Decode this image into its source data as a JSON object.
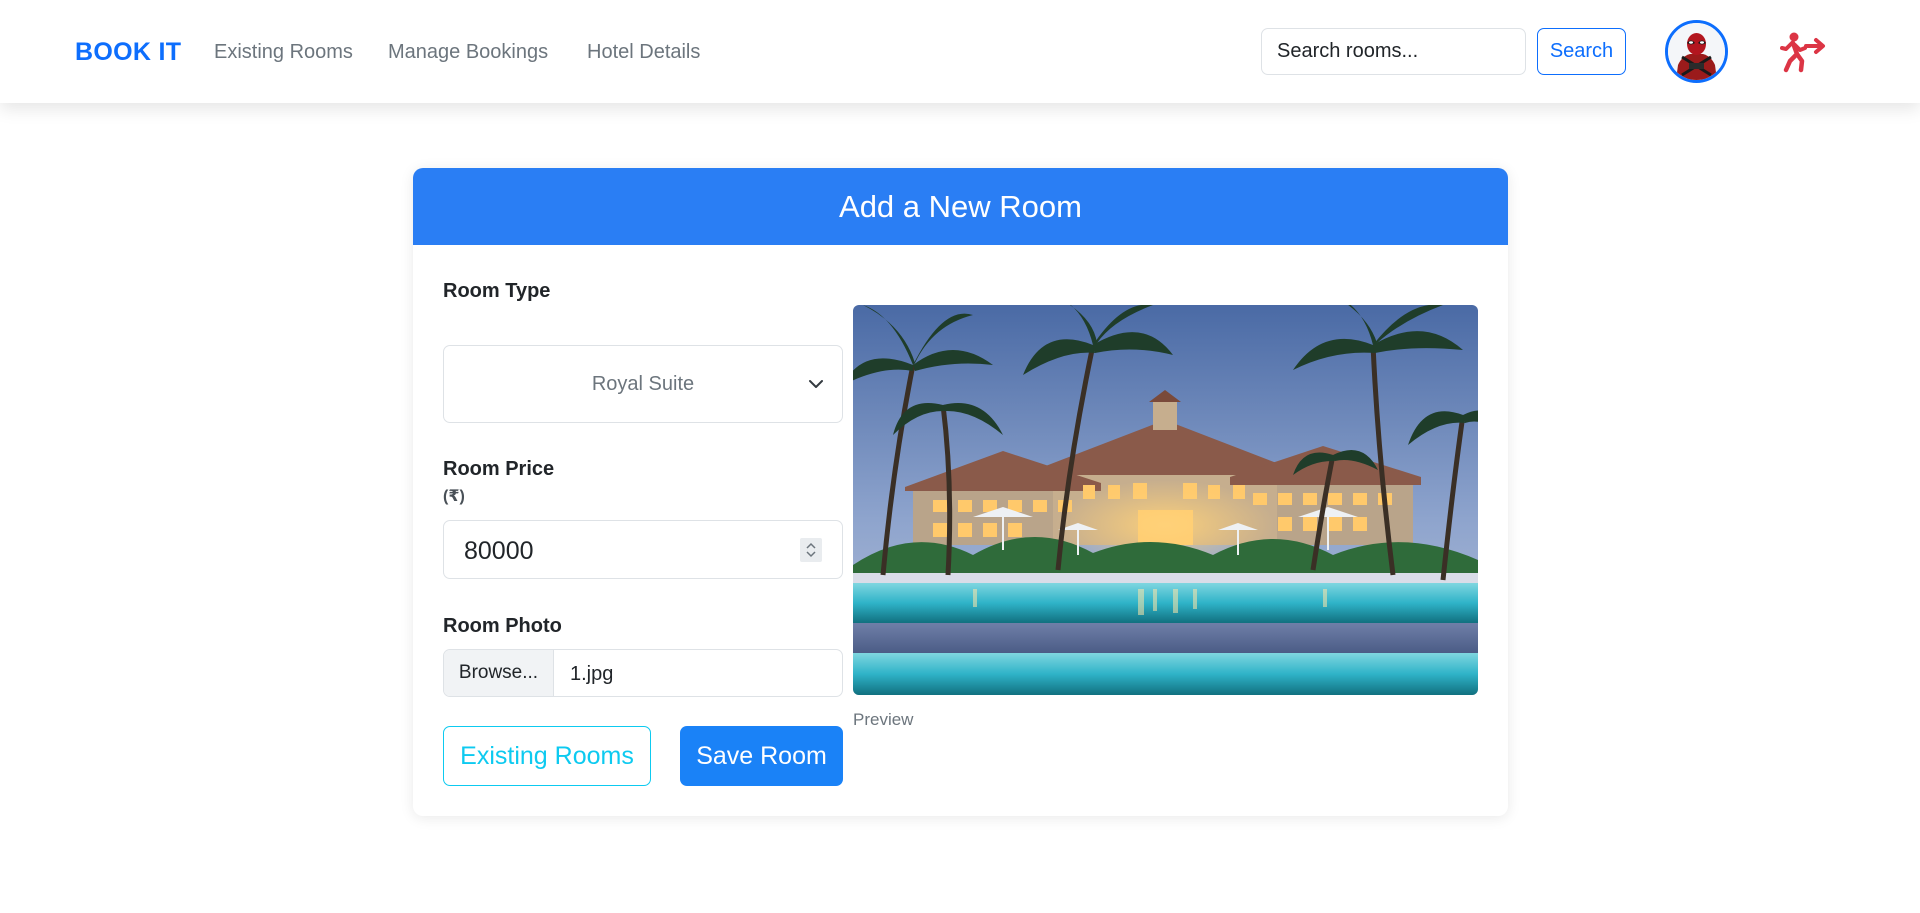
{
  "navbar": {
    "brand": "BOOK IT",
    "links": [
      "Existing Rooms",
      "Manage Bookings",
      "Hotel Details"
    ],
    "search_placeholder": "Search rooms...",
    "search_button": "Search",
    "logout_icon": "logout-run-icon"
  },
  "form": {
    "title": "Add a New Room",
    "room_type_label": "Room Type",
    "room_type_value": "Royal Suite",
    "room_price_label": "Room Price",
    "room_price_unit": "(₹)",
    "room_price_value": "80000",
    "room_photo_label": "Room Photo",
    "browse_label": "Browse...",
    "file_name": "1.jpg",
    "preview_caption": "Preview",
    "existing_rooms_button": "Existing Rooms",
    "save_button": "Save Room"
  },
  "colors": {
    "brand": "#0d6efd",
    "header": "#2a7ef4",
    "outline_button": "#0dcaf0",
    "logout": "#dc3545"
  }
}
